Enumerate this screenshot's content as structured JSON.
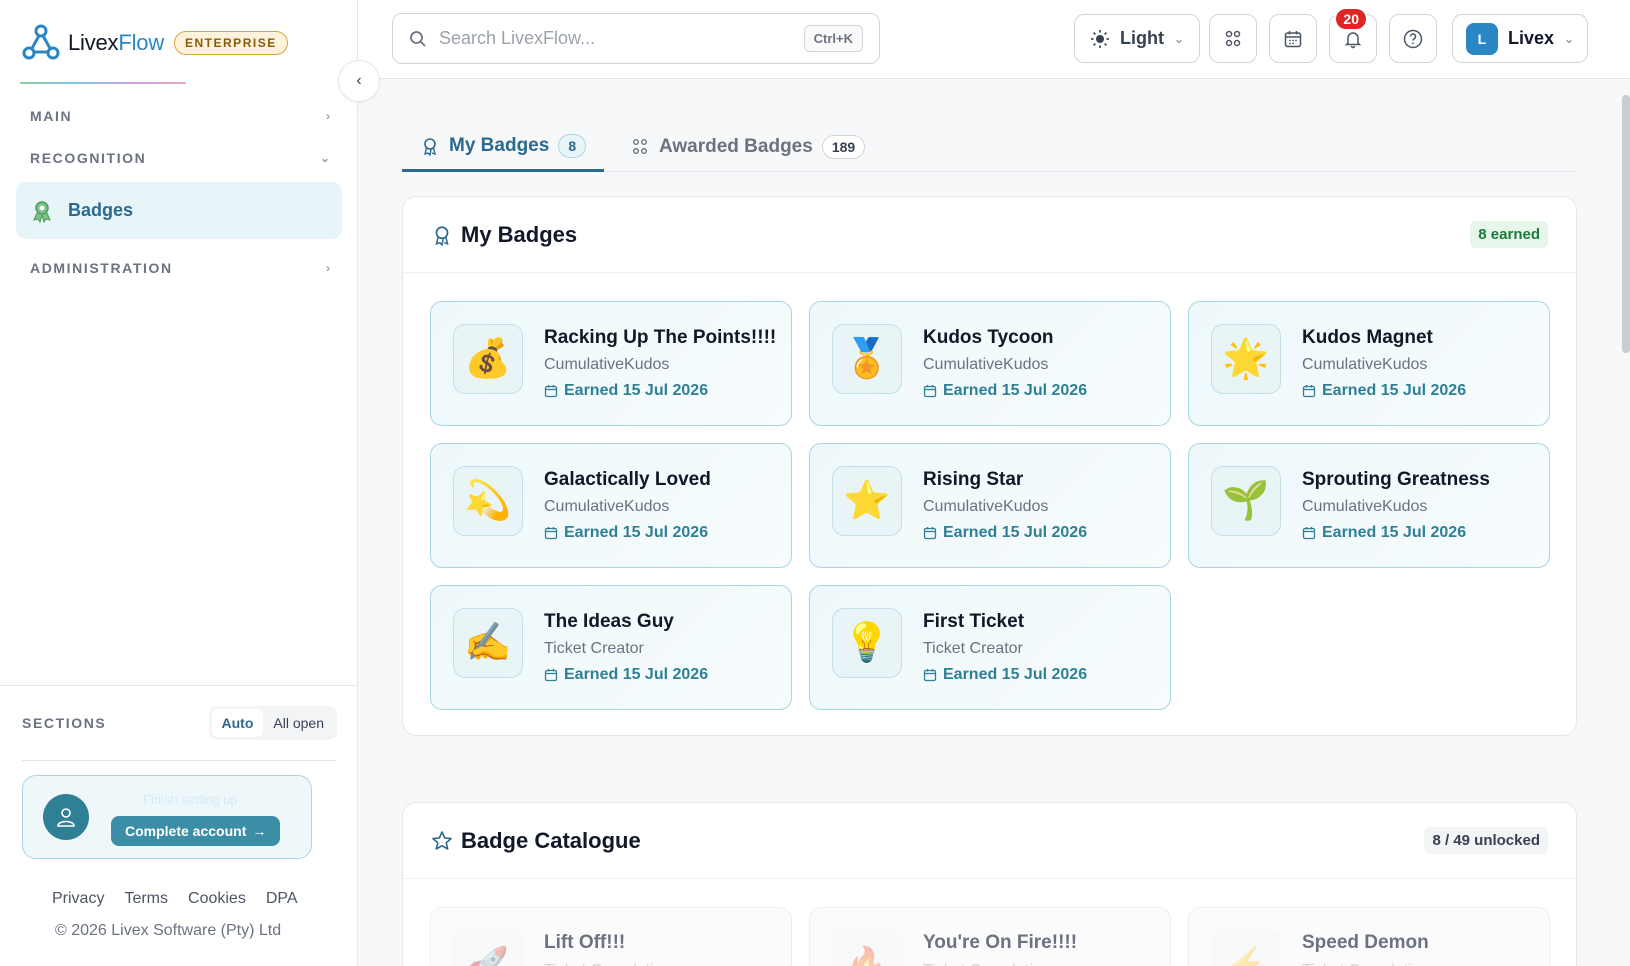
{
  "brand": {
    "name_part1": "Livex",
    "name_part2": "Flow",
    "edition": "ENTERPRISE"
  },
  "sidebar": {
    "sections": [
      {
        "label": "MAIN",
        "state": "collapsed"
      },
      {
        "label": "RECOGNITION",
        "state": "expanded"
      },
      {
        "label": "ADMINISTRATION",
        "state": "collapsed"
      }
    ],
    "active_item": {
      "label": "Badges",
      "icon": "badge-icon"
    },
    "sections_mode": {
      "label": "SECTIONS",
      "options": [
        "Auto",
        "All open"
      ],
      "selected": "Auto"
    },
    "account_card": {
      "faded_text": "Finish setting up",
      "button_label": "Complete account"
    },
    "footer_links": [
      "Privacy",
      "Terms",
      "Cookies",
      "DPA"
    ],
    "copyright": "© 2026 Livex Software (Pty) Ltd"
  },
  "topbar": {
    "search_placeholder": "Search LivexFlow...",
    "search_shortcut": "Ctrl+K",
    "theme_label": "Light",
    "notification_count": "20",
    "user_initial": "L",
    "user_name": "Livex"
  },
  "tabs": [
    {
      "label": "My Badges",
      "count": "8",
      "active": true
    },
    {
      "label": "Awarded Badges",
      "count": "189",
      "active": false
    }
  ],
  "my_badges": {
    "title": "My Badges",
    "earned_pill": "8 earned",
    "items": [
      {
        "name": "Racking Up The Points!!!!",
        "category": "CumulativeKudos",
        "earned": "Earned 15 Jul 2026",
        "emoji": "💰"
      },
      {
        "name": "Kudos Tycoon",
        "category": "CumulativeKudos",
        "earned": "Earned 15 Jul 2026",
        "emoji": "🏅"
      },
      {
        "name": "Kudos Magnet",
        "category": "CumulativeKudos",
        "earned": "Earned 15 Jul 2026",
        "emoji": "🌟"
      },
      {
        "name": "Galactically Loved",
        "category": "CumulativeKudos",
        "earned": "Earned 15 Jul 2026",
        "emoji": "💫"
      },
      {
        "name": "Rising Star",
        "category": "CumulativeKudos",
        "earned": "Earned 15 Jul 2026",
        "emoji": "⭐"
      },
      {
        "name": "Sprouting Greatness",
        "category": "CumulativeKudos",
        "earned": "Earned 15 Jul 2026",
        "emoji": "🌱"
      },
      {
        "name": "The Ideas Guy",
        "category": "Ticket Creator",
        "earned": "Earned 15 Jul 2026",
        "emoji": "✍️"
      },
      {
        "name": "First Ticket",
        "category": "Ticket Creator",
        "earned": "Earned 15 Jul 2026",
        "emoji": "💡"
      }
    ]
  },
  "catalogue": {
    "title": "Badge Catalogue",
    "unlocked_pill": "8 / 49 unlocked",
    "items": [
      {
        "name": "Lift Off!!!",
        "category": "Ticket Completion",
        "emoji": "🚀"
      },
      {
        "name": "You're On Fire!!!!",
        "category": "Ticket Completion",
        "emoji": "🔥"
      },
      {
        "name": "Speed Demon",
        "category": "Ticket Completion",
        "emoji": "⚡"
      }
    ]
  },
  "colors": {
    "accent": "#2b6a8e",
    "brand_blue": "#2b86c5",
    "notification": "#dc2626",
    "success": "#1d7a3b"
  }
}
